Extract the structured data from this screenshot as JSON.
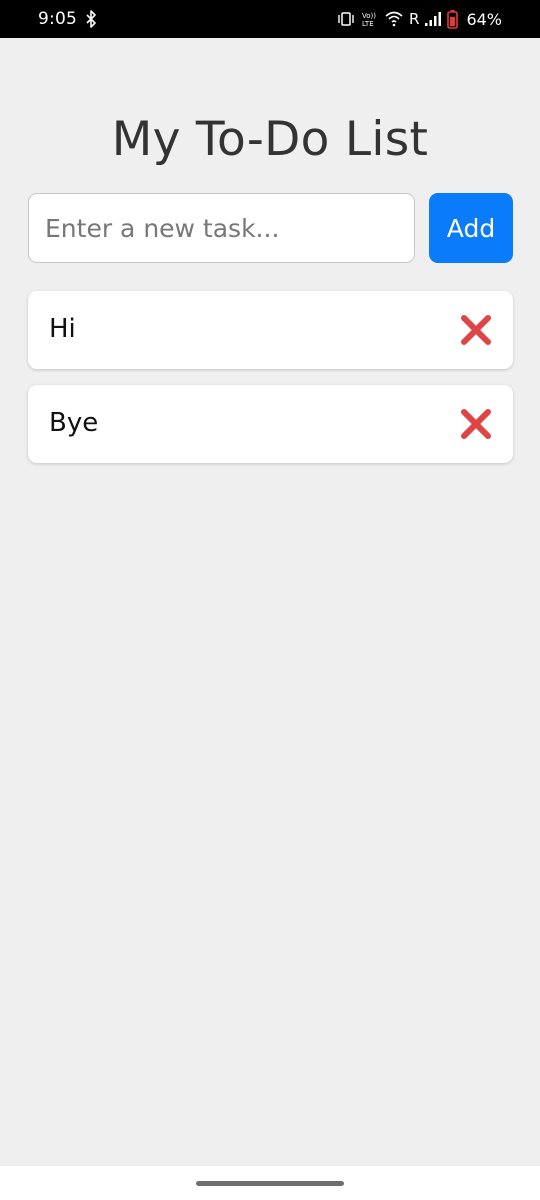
{
  "status_bar": {
    "time": "9:05",
    "network_r": "R",
    "battery_percent": "64%",
    "icons": [
      "bluetooth-icon",
      "vibrate-icon",
      "volte-icon",
      "wifi-icon",
      "signal-icon",
      "battery-icon"
    ]
  },
  "app": {
    "title": "My To-Do List",
    "input": {
      "placeholder": "Enter a new task...",
      "value": ""
    },
    "add_button_label": "Add",
    "accent_color": "#0a7bf9",
    "delete_icon_color": "#e04545",
    "tasks": [
      {
        "text": "Hi",
        "delete_icon": "red-x-icon"
      },
      {
        "text": "Bye",
        "delete_icon": "red-x-icon"
      }
    ]
  }
}
